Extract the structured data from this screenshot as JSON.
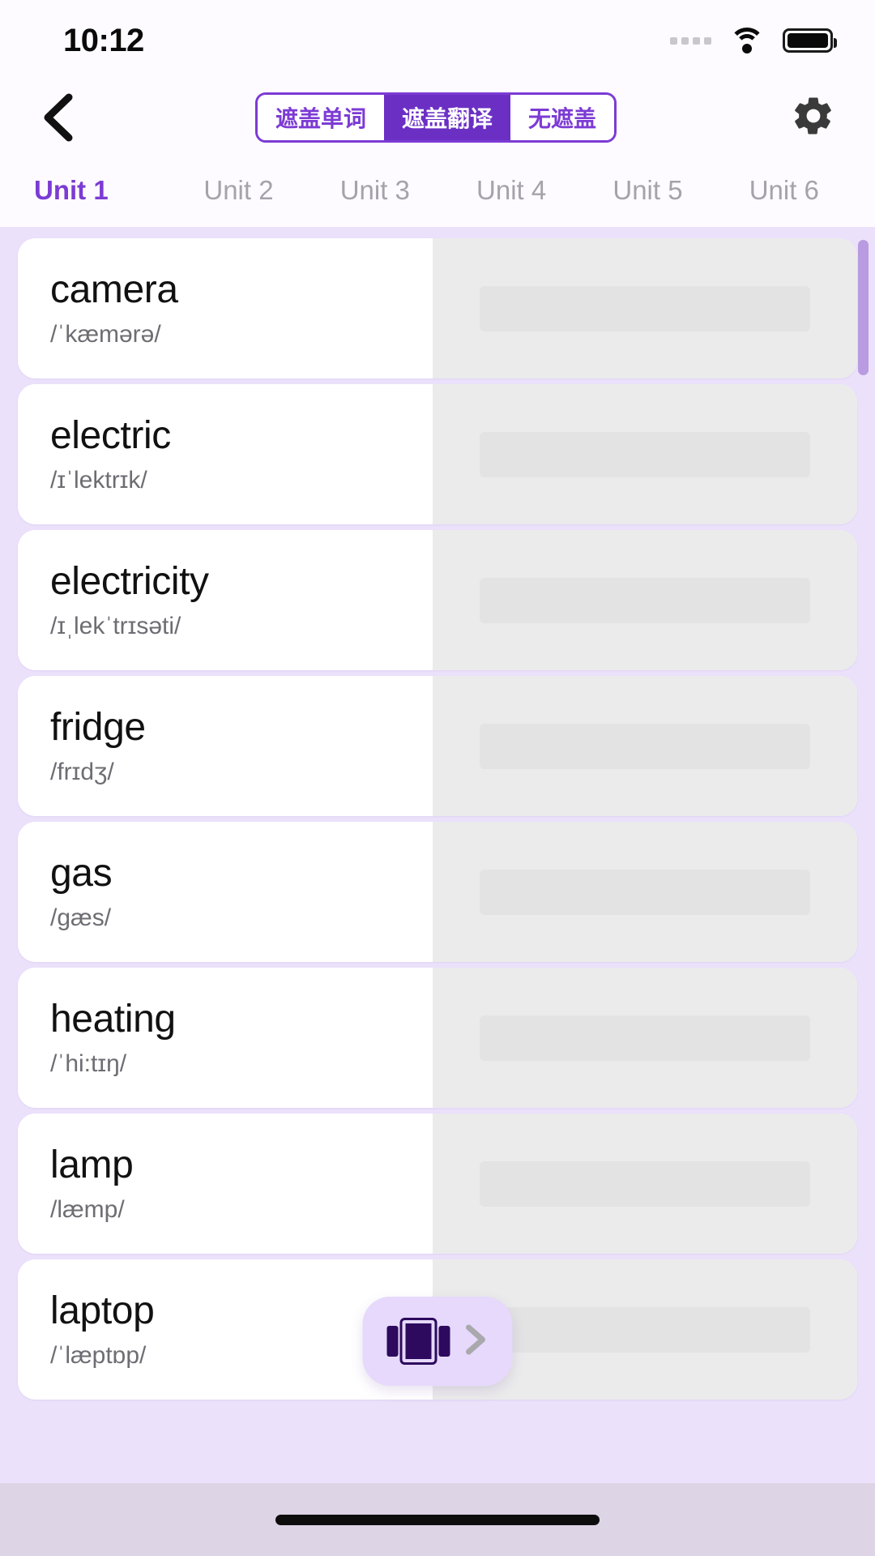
{
  "status_bar": {
    "time": "10:12",
    "signal_icon": "signal-dots-icon",
    "wifi_icon": "wifi-icon",
    "battery_icon": "battery-icon"
  },
  "header": {
    "back_icon": "chevron-left-icon",
    "settings_icon": "gear-icon",
    "segmented_control": {
      "selected_index": 1,
      "options": [
        {
          "label": "遮盖单词",
          "active": false
        },
        {
          "label": "遮盖翻译",
          "active": true
        },
        {
          "label": "无遮盖",
          "active": false
        }
      ]
    }
  },
  "unit_tabs": {
    "active_index": 0,
    "items": [
      {
        "label": "Unit 1",
        "active": true
      },
      {
        "label": "Unit 2",
        "active": false
      },
      {
        "label": "Unit 3",
        "active": false
      },
      {
        "label": "Unit 4",
        "active": false
      },
      {
        "label": "Unit 5",
        "active": false
      },
      {
        "label": "Unit 6",
        "active": false
      }
    ]
  },
  "word_list": {
    "translation_masked": true,
    "items": [
      {
        "word": "camera",
        "phonetic": "/ˈkæmərə/"
      },
      {
        "word": "electric",
        "phonetic": "/ɪˈlektrɪk/"
      },
      {
        "word": "electricity",
        "phonetic": "/ɪˌlekˈtrɪsəti/"
      },
      {
        "word": "fridge",
        "phonetic": "/frɪdʒ/"
      },
      {
        "word": "gas",
        "phonetic": "/gæs/"
      },
      {
        "word": "heating",
        "phonetic": "/ˈhi:tɪŋ/"
      },
      {
        "word": "lamp",
        "phonetic": "/læmp/"
      },
      {
        "word": "laptop",
        "phonetic": "/ˈlæptɒp/"
      }
    ]
  },
  "floating_button": {
    "carousel_icon": "card-carousel-icon",
    "next_icon": "chevron-right-icon"
  },
  "home_indicator": {
    "icon": "home-indicator"
  },
  "colors": {
    "accent_purple": "#7c3bd4",
    "accent_purple_dark": "#6b2fc4",
    "list_background": "#ebe1fb",
    "card_background": "#ffffff",
    "mask_panel": "#ebebeb",
    "mask_bar": "#e3e3e3",
    "fab_background": "#e6d9fb",
    "fab_icon": "#2d0a5e",
    "inactive_tab": "#a5a3aa",
    "phonetic_text": "#6d6d73"
  }
}
